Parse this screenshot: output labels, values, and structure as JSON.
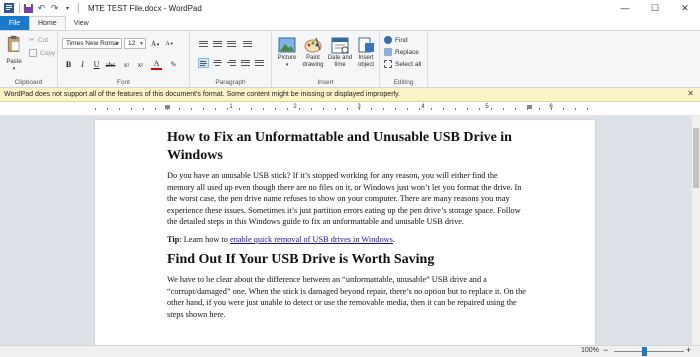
{
  "window": {
    "title": "MTE TEST File.docx - WordPad",
    "minimize": "—",
    "maximize": "☐",
    "close": "✕"
  },
  "tabs": [
    {
      "label": "File"
    },
    {
      "label": "Home"
    },
    {
      "label": "View"
    }
  ],
  "clipboard": {
    "paste": "Paste",
    "cut": "Cut",
    "copy": "Copy",
    "group": "Clipboard"
  },
  "font": {
    "family": "Times New Roma",
    "size": "12",
    "group": "Font"
  },
  "paragraph": {
    "group": "Paragraph"
  },
  "insert": {
    "picture": "Picture",
    "paint": "Paint drawing",
    "datetime": "Date and time",
    "object": "Insert object",
    "group": "Insert"
  },
  "editing": {
    "find": "Find",
    "replace": "Replace",
    "select_all": "Select all",
    "group": "Editing"
  },
  "infobar": {
    "message": "WordPad does not support all of the features of this document's format. Some content might be missing or displayed improperly.",
    "close": "✕"
  },
  "ruler": {
    "labels": [
      "1",
      "2",
      "3",
      "4",
      "5",
      "6"
    ]
  },
  "document": {
    "heading1": "How to Fix an Unformattable and Unusable USB Drive in Windows",
    "para1": "Do you have an unusable USB stick? If it’s stopped working for any reason, you will either find the memory all used up even though there are no files on it, or Windows just won’t let you format the drive. In the worst case, the pen drive name refuses to show on your computer. There are many reasons you may experience these issues. Sometimes it’s just partition errors eating up the pen drive’s storage space. Follow the detailed steps in this Windows guide to fix an unformattable and unusable USB drive.",
    "tip_label": "Tip",
    "tip_text": ": Learn how to ",
    "tip_link": "enable quick removal of USB drives in Windows",
    "tip_end": ".",
    "heading2": "Find Out If Your USB Drive is Worth Saving",
    "para2": "We have to be clear about the difference between an “unformattable, unusable” USB drive and a “corrupt/damaged” one. When the stick is damaged beyond repair, there’s no option but to replace it. On the other hand, if you were just unable to detect or use the removable media, then it can be repaired using the steps shown here."
  },
  "status": {
    "zoom": "100%",
    "zoom_level": 1.0,
    "minus": "−",
    "plus": "+"
  },
  "colors": {
    "accent": "#1979ca",
    "infobar": "#fcf3c6",
    "doc_bg": "#dde2e9"
  }
}
